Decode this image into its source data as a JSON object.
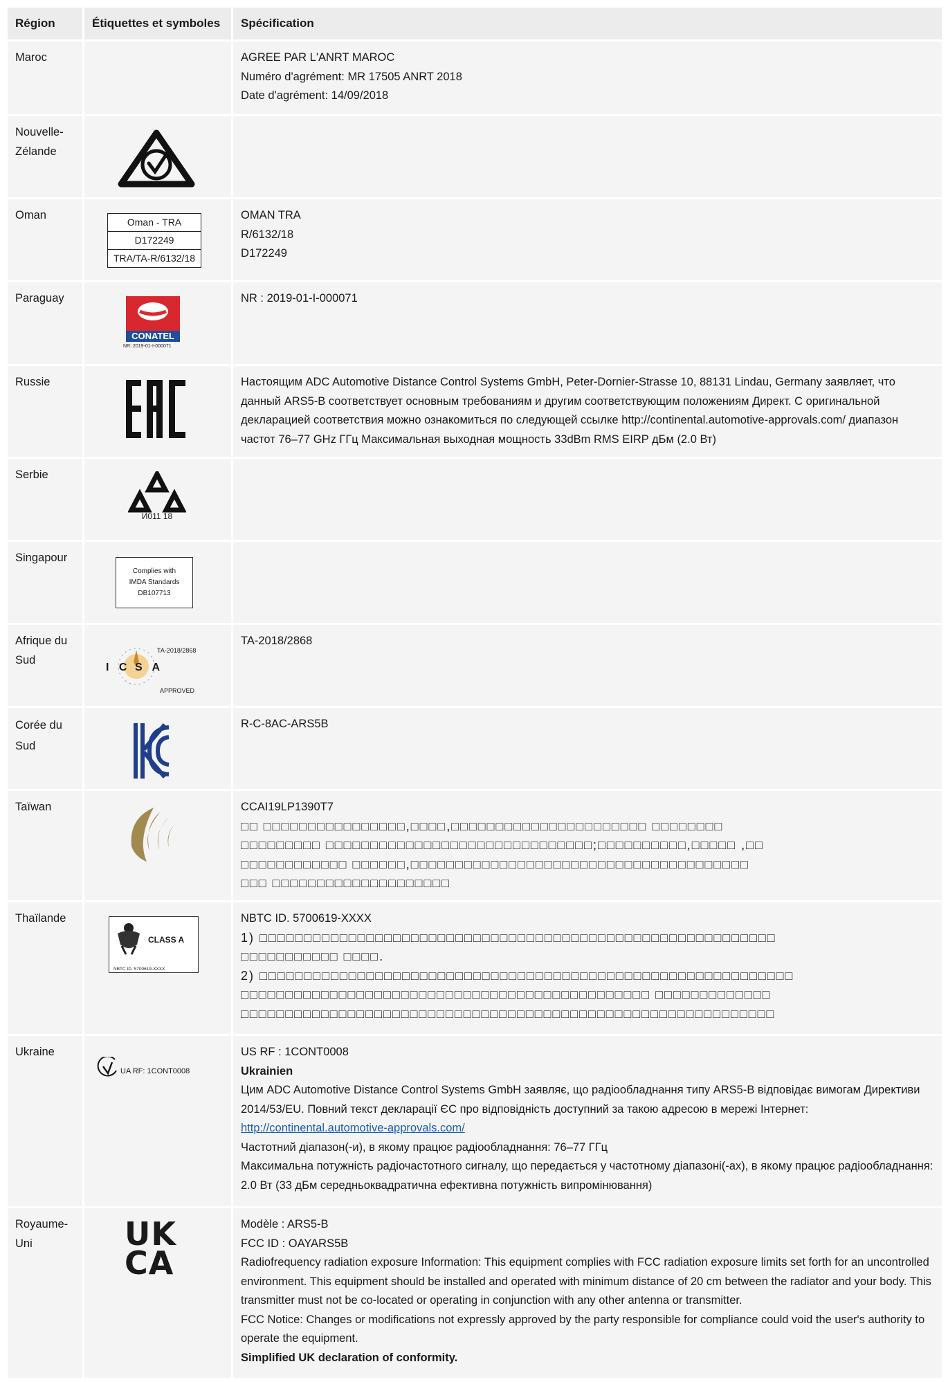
{
  "headers": {
    "region": "Région",
    "labels": "Étiquettes et symboles",
    "spec": "Spécification"
  },
  "rows": [
    {
      "region": "Maroc",
      "spec": [
        "AGREE PAR L'ANRT MAROC",
        "Numéro d'agrément: MR 17505 ANRT 2018",
        "Date d'agrément: 14/09/2018"
      ]
    },
    {
      "region": "Nouvelle-Zélande",
      "logo": "rcm-check-mark-icon"
    },
    {
      "region": "Oman",
      "logo_text": [
        "Oman  -  TRA",
        "D172249",
        "TRA/TA-R/6132/18"
      ],
      "spec": [
        "OMAN TRA",
        "R/6132/18",
        "D172249"
      ]
    },
    {
      "region": "Paraguay",
      "logo_text": [
        "CONATEL",
        "NR: 2019-01-I-000071"
      ],
      "spec": [
        "NR : 2019-01-I-000071"
      ]
    },
    {
      "region": "Russie",
      "logo": "eac-mark-icon",
      "spec_para": "Настоящим ADC Automotive Distance Control Systems GmbH, Peter-Dornier-Strasse 10, 88131 Lindau, Germany заявляет, что данный ARS5-B соответствует основным требованиям и другим соответствующим положениям Директ. С оригинальной декларацией соответствия можно ознакомиться по следующей ссылке http://continental.automotive-approvals.com/ диапазон частот 76–77 GHz ГГц Максимальная выходная мощность 33dBm RMS EIRP дБм (2.0 Вт)"
    },
    {
      "region": "Serbie",
      "logo": "serbia-triangles-icon",
      "logo_text": [
        "И011 18"
      ]
    },
    {
      "region": "Singapour",
      "logo_text": [
        "Complies with",
        "IMDA Standards",
        "DB107713"
      ]
    },
    {
      "region": "Afrique du Sud",
      "logo_text": [
        "TA-2018/2868",
        "I C",
        "S A",
        "APPROVED"
      ],
      "spec": [
        "TA-2018/2868"
      ]
    },
    {
      "region": "Corée du Sud",
      "logo": "kc-mark-icon",
      "spec": [
        "R-C-8AC-ARS5B"
      ]
    },
    {
      "region": "Taïwan",
      "logo": "ncc-mark-icon",
      "spec": [
        "CCAI19LP1390T7"
      ],
      "spec_boxes": [
        "□□ □□□□□□□□□□□□□□□□,□□□□,□□□□□□□□□□□□□□□□□□□□□□ □□□□□□□□",
        "□□□□□□□□□ □□□□□□□□□□□□□□□□□□□□□□□□□□□□□□;□□□□□□□□□□,□□□□□ ,□□",
        "□□□□□□□□□□□□ □□□□□□,□□□□□□□□□□□□□□□□□□□□□□□□□□□□□□□□□□□□□□",
        "□□□ □□□□□□□□□□□□□□□□□□□□"
      ]
    },
    {
      "region": "Thaïlande",
      "logo_text": [
        "CLASS A",
        "NBTC ID. 5700619-XXXX"
      ],
      "spec": [
        "NBTC ID. 5700619-XXXX"
      ],
      "spec_boxes": [
        "1) □□□□□□□□□□□□□□□□□□□□□□□□□□□□□□□□□□□□□□□□□□□□□□□□□□□□□□□□□□",
        "□□□□□□□□□□□ □□□□.",
        "2) □□□□□□□□□□□□□□□□□□□□□□□□□□□□□□□□□□□□□□□□□□□□□□□□□□□□□□□□□□□□",
        "□□□□□□□□□□□□□□□□□□□□□□□□□□□□□□□□□□□□□□□□□□□□□□ □□□□□□□□□□□□□",
        "□□□□□□□□□□□□□□□□□□□□□□□□□□□□□□□□□□□□□□□□□□□□□□□□□□□□□□□□□□□□"
      ]
    },
    {
      "region": "Ukraine",
      "logo_text": [
        "UA RF: 1CONT0008"
      ],
      "spec": [
        "US RF : 1CONT0008"
      ],
      "spec_bold": "Ukrainien",
      "spec_para1": "Цим ADC Automotive Distance Control Systems GmbH заявляє, що радіообладнання типу ARS5-B відповідає вимогам Директиви 2014/53/EU. Повний текст декларації ЄС про відповідність доступний за такою адресою в мережі Інтернет: ",
      "spec_link": "http://continental.automotive-approvals.com/",
      "spec_para2": "Частотний діапазон(-и), в якому працює радіообладнання: 76–77 ГГц",
      "spec_para3": "Максимальна потужність радіочастотного сигналу, що передається у частотному діапазоні(-ах), в якому працює радіообладнання: 2.0 Вт (33 дБм середньоквадратична ефективна потужність випромінювання)"
    },
    {
      "region": "Royaume-Uni",
      "logo_text": [
        "UK",
        "CA"
      ],
      "spec": [
        "Modèle : ARS5-B",
        "FCC ID : OAYARS5B"
      ],
      "spec_para1": "Radiofrequency radiation exposure Information: This equipment complies with FCC radiation exposure limits set forth for an uncontrolled environment. This equipment should be installed and operated with minimum distance of 20 cm between the radiator and your body. This transmitter must not be co-located or operating in conjunction with any other antenna or transmitter.",
      "spec_para2": "FCC Notice: Changes or modifications not expressly approved by the party responsible for compliance could void the user's authority to operate the equipment.",
      "spec_bold": "Simplified UK declaration of conformity."
    }
  ],
  "colors": {
    "header_bg": "#ececec",
    "cell_bg": "#f4f4f4",
    "conatel_red": "#d7282f",
    "conatel_blue": "#1f4e9c",
    "kc_blue": "#1f3f8a",
    "ncc_gold": "#a08a4e",
    "link_blue": "#1a5fb4"
  }
}
